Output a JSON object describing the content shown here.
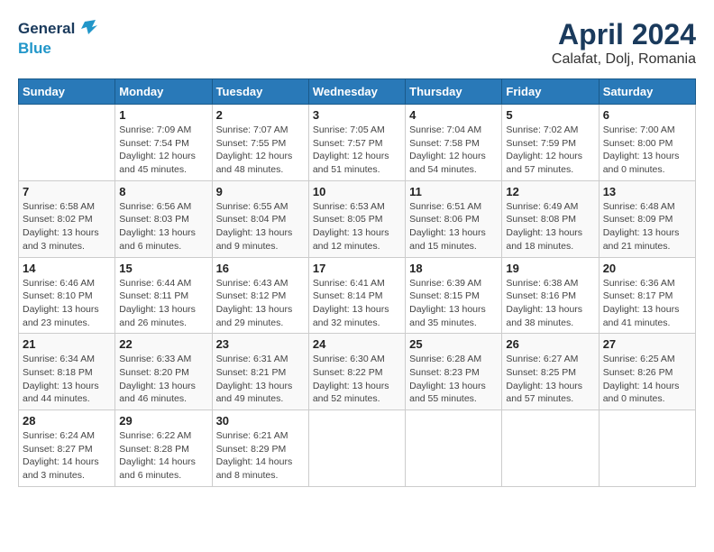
{
  "header": {
    "logo_line1": "General",
    "logo_line2": "Blue",
    "month": "April 2024",
    "location": "Calafat, Dolj, Romania"
  },
  "weekdays": [
    "Sunday",
    "Monday",
    "Tuesday",
    "Wednesday",
    "Thursday",
    "Friday",
    "Saturday"
  ],
  "weeks": [
    [
      {
        "day": "",
        "info": ""
      },
      {
        "day": "1",
        "info": "Sunrise: 7:09 AM\nSunset: 7:54 PM\nDaylight: 12 hours and 45 minutes."
      },
      {
        "day": "2",
        "info": "Sunrise: 7:07 AM\nSunset: 7:55 PM\nDaylight: 12 hours and 48 minutes."
      },
      {
        "day": "3",
        "info": "Sunrise: 7:05 AM\nSunset: 7:57 PM\nDaylight: 12 hours and 51 minutes."
      },
      {
        "day": "4",
        "info": "Sunrise: 7:04 AM\nSunset: 7:58 PM\nDaylight: 12 hours and 54 minutes."
      },
      {
        "day": "5",
        "info": "Sunrise: 7:02 AM\nSunset: 7:59 PM\nDaylight: 12 hours and 57 minutes."
      },
      {
        "day": "6",
        "info": "Sunrise: 7:00 AM\nSunset: 8:00 PM\nDaylight: 13 hours and 0 minutes."
      }
    ],
    [
      {
        "day": "7",
        "info": "Sunrise: 6:58 AM\nSunset: 8:02 PM\nDaylight: 13 hours and 3 minutes."
      },
      {
        "day": "8",
        "info": "Sunrise: 6:56 AM\nSunset: 8:03 PM\nDaylight: 13 hours and 6 minutes."
      },
      {
        "day": "9",
        "info": "Sunrise: 6:55 AM\nSunset: 8:04 PM\nDaylight: 13 hours and 9 minutes."
      },
      {
        "day": "10",
        "info": "Sunrise: 6:53 AM\nSunset: 8:05 PM\nDaylight: 13 hours and 12 minutes."
      },
      {
        "day": "11",
        "info": "Sunrise: 6:51 AM\nSunset: 8:06 PM\nDaylight: 13 hours and 15 minutes."
      },
      {
        "day": "12",
        "info": "Sunrise: 6:49 AM\nSunset: 8:08 PM\nDaylight: 13 hours and 18 minutes."
      },
      {
        "day": "13",
        "info": "Sunrise: 6:48 AM\nSunset: 8:09 PM\nDaylight: 13 hours and 21 minutes."
      }
    ],
    [
      {
        "day": "14",
        "info": "Sunrise: 6:46 AM\nSunset: 8:10 PM\nDaylight: 13 hours and 23 minutes."
      },
      {
        "day": "15",
        "info": "Sunrise: 6:44 AM\nSunset: 8:11 PM\nDaylight: 13 hours and 26 minutes."
      },
      {
        "day": "16",
        "info": "Sunrise: 6:43 AM\nSunset: 8:12 PM\nDaylight: 13 hours and 29 minutes."
      },
      {
        "day": "17",
        "info": "Sunrise: 6:41 AM\nSunset: 8:14 PM\nDaylight: 13 hours and 32 minutes."
      },
      {
        "day": "18",
        "info": "Sunrise: 6:39 AM\nSunset: 8:15 PM\nDaylight: 13 hours and 35 minutes."
      },
      {
        "day": "19",
        "info": "Sunrise: 6:38 AM\nSunset: 8:16 PM\nDaylight: 13 hours and 38 minutes."
      },
      {
        "day": "20",
        "info": "Sunrise: 6:36 AM\nSunset: 8:17 PM\nDaylight: 13 hours and 41 minutes."
      }
    ],
    [
      {
        "day": "21",
        "info": "Sunrise: 6:34 AM\nSunset: 8:18 PM\nDaylight: 13 hours and 44 minutes."
      },
      {
        "day": "22",
        "info": "Sunrise: 6:33 AM\nSunset: 8:20 PM\nDaylight: 13 hours and 46 minutes."
      },
      {
        "day": "23",
        "info": "Sunrise: 6:31 AM\nSunset: 8:21 PM\nDaylight: 13 hours and 49 minutes."
      },
      {
        "day": "24",
        "info": "Sunrise: 6:30 AM\nSunset: 8:22 PM\nDaylight: 13 hours and 52 minutes."
      },
      {
        "day": "25",
        "info": "Sunrise: 6:28 AM\nSunset: 8:23 PM\nDaylight: 13 hours and 55 minutes."
      },
      {
        "day": "26",
        "info": "Sunrise: 6:27 AM\nSunset: 8:25 PM\nDaylight: 13 hours and 57 minutes."
      },
      {
        "day": "27",
        "info": "Sunrise: 6:25 AM\nSunset: 8:26 PM\nDaylight: 14 hours and 0 minutes."
      }
    ],
    [
      {
        "day": "28",
        "info": "Sunrise: 6:24 AM\nSunset: 8:27 PM\nDaylight: 14 hours and 3 minutes."
      },
      {
        "day": "29",
        "info": "Sunrise: 6:22 AM\nSunset: 8:28 PM\nDaylight: 14 hours and 6 minutes."
      },
      {
        "day": "30",
        "info": "Sunrise: 6:21 AM\nSunset: 8:29 PM\nDaylight: 14 hours and 8 minutes."
      },
      {
        "day": "",
        "info": ""
      },
      {
        "day": "",
        "info": ""
      },
      {
        "day": "",
        "info": ""
      },
      {
        "day": "",
        "info": ""
      }
    ]
  ]
}
